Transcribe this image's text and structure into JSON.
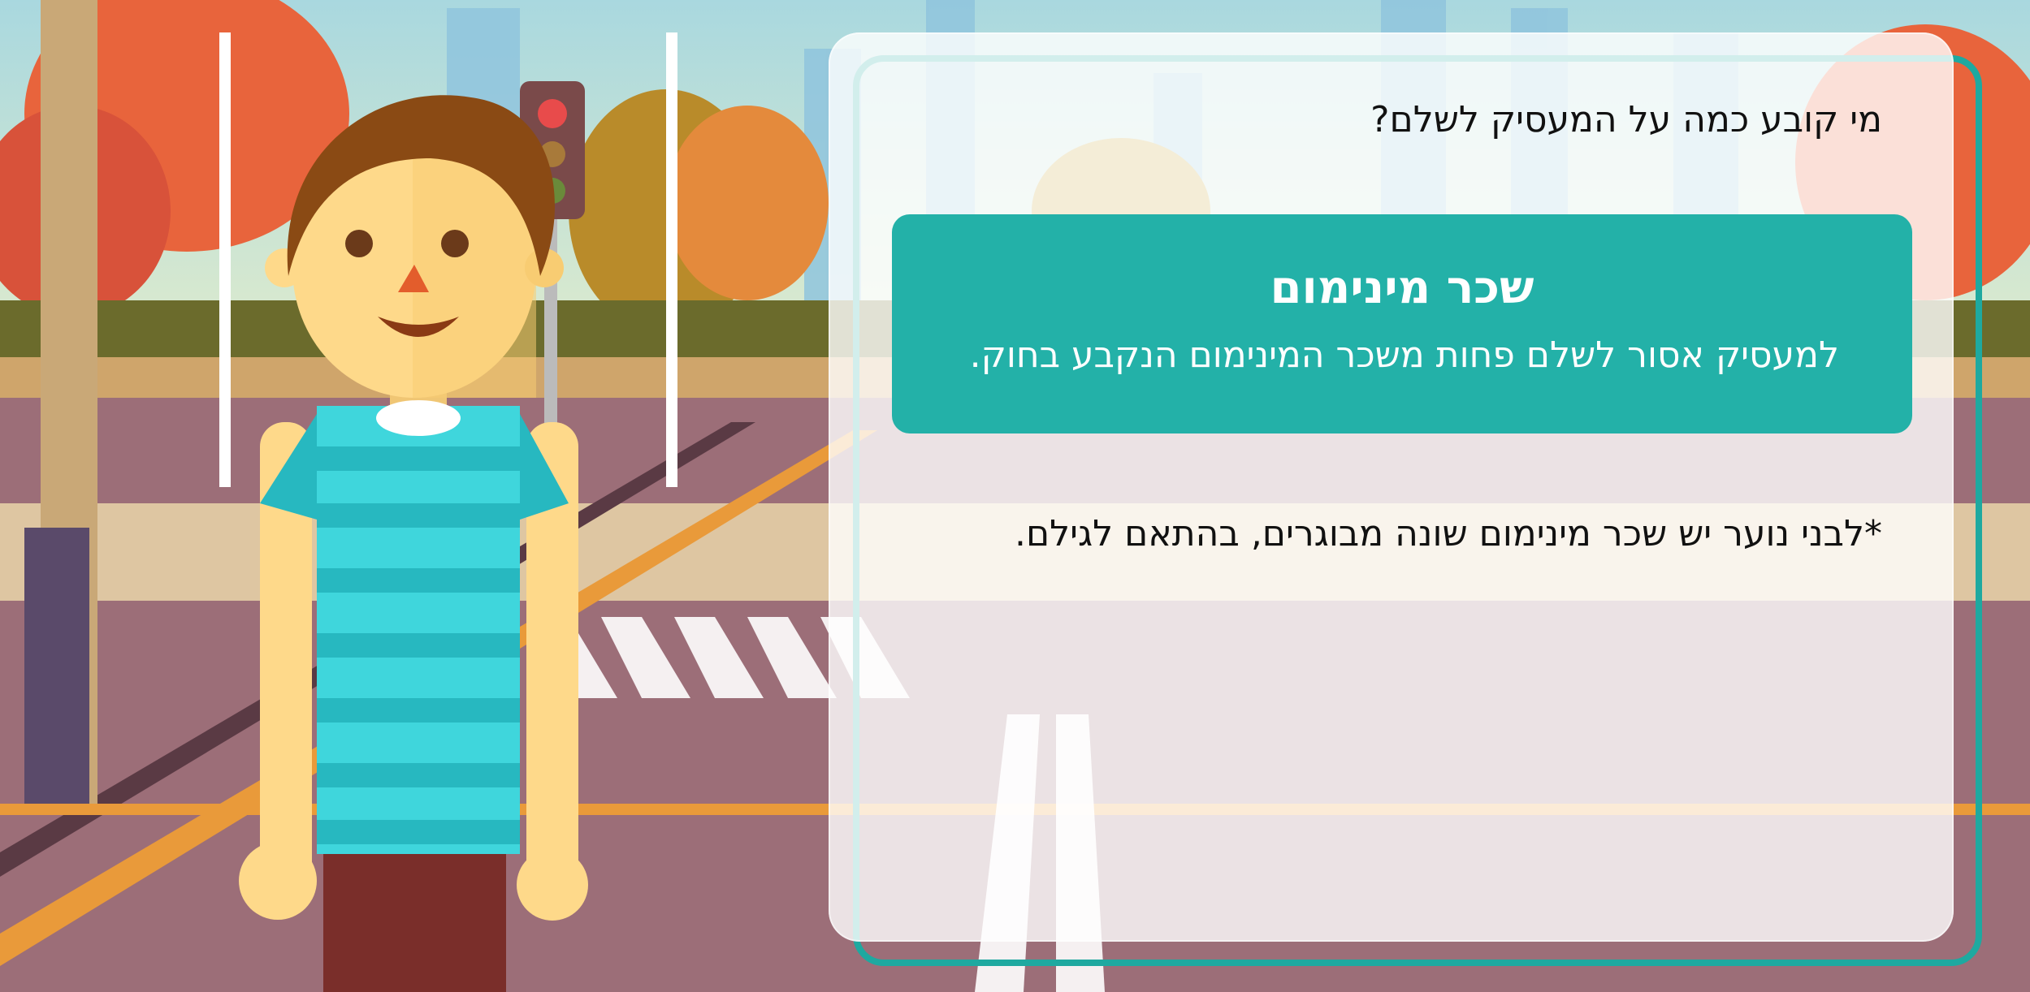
{
  "card": {
    "question": "מי קובע כמה על המעסיק לשלם?",
    "term": {
      "title": "שכר מינימום",
      "definition": "למעסיק אסור לשלם פחות משכר המינימום הנקבע בחוק."
    },
    "footnote": "*לבני נוער יש שכר מינימום שונה מבוגרים, בהתאם לגילם."
  },
  "colors": {
    "accent": "#23b1a8",
    "frame": "#1ea9a0",
    "shirt": "#3fd6dc",
    "shirt_stripe": "#27b8c0",
    "skin": "#fed98a",
    "hair": "#8a4a14",
    "pants": "#7a2e2a"
  }
}
